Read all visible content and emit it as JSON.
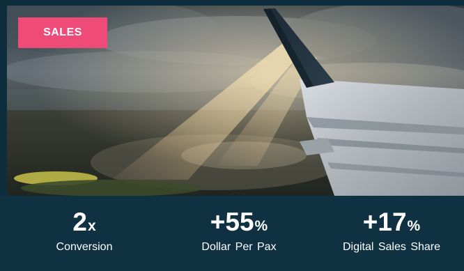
{
  "badge": {
    "label": "SALES",
    "color": "#ef4b78"
  },
  "hero": {
    "image": "airplane-wing-over-city-with-sunbeams"
  },
  "stats": [
    {
      "number": "2",
      "unit": "x",
      "caption": "Conversion"
    },
    {
      "number": "+55",
      "unit": "%",
      "caption": "Dollar Per Pax"
    },
    {
      "number": "+17",
      "unit": "%",
      "caption": "Digital Sales Share"
    }
  ],
  "colors": {
    "background": "#0e2e3e",
    "stats_panel": "#0f3142",
    "text": "#ffffff"
  }
}
